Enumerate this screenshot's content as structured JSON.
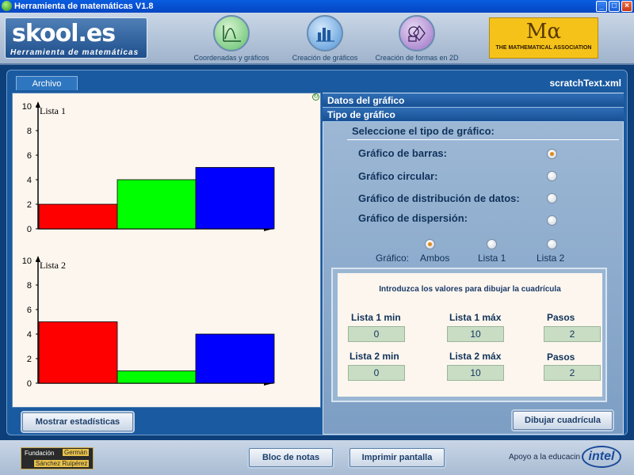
{
  "window": {
    "title": "Herramienta de matemáticas V1.8"
  },
  "logo": {
    "main": "skool.es",
    "sub": "Herramienta de matemáticas"
  },
  "nav": [
    {
      "label": "Coordenadas y gráficos",
      "icon": "coordinate-graph-icon"
    },
    {
      "label": "Creación de gráficos",
      "icon": "bar-chart-icon"
    },
    {
      "label": "Creación de formas en 2D",
      "icon": "shapes-icon"
    }
  ],
  "mathassoc": {
    "mark": "Mα",
    "text": "THE MATHEMATICAL ASSOCIATION"
  },
  "tab": {
    "archivo": "Archivo"
  },
  "file": {
    "name": "scratchText.xml"
  },
  "sections": {
    "datos": "Datos del gráfico",
    "tipo": "Tipo de gráfico"
  },
  "selector": {
    "title": "Seleccione el tipo de gráfico:",
    "options": [
      {
        "label": "Gráfico de barras:",
        "selected": true
      },
      {
        "label": "Gráfico circular:",
        "selected": false
      },
      {
        "label": "Gráfico de distribución de datos:",
        "selected": false
      },
      {
        "label": "Gráfico de dispersión:",
        "selected": false
      }
    ],
    "grafico_label": "Gráfico:",
    "show": [
      {
        "label": "Ambos",
        "selected": true
      },
      {
        "label": "Lista 1",
        "selected": false
      },
      {
        "label": "Lista 2",
        "selected": false
      }
    ]
  },
  "grid": {
    "title": "Introduzca los valores para dibujar la cuadrícula",
    "row1": {
      "min_label": "Lista 1 min",
      "min": "0",
      "max_label": "Lista 1 máx",
      "max": "10",
      "steps_label": "Pasos",
      "steps": "2"
    },
    "row2": {
      "min_label": "Lista 2 min",
      "min": "0",
      "max_label": "Lista 2 máx",
      "max": "10",
      "steps_label": "Pasos",
      "steps": "2"
    }
  },
  "buttons": {
    "stats": "Mostrar estadísticas",
    "draw": "Dibujar cuadrícula",
    "notes": "Bloc de notas",
    "print": "Imprimir pantalla"
  },
  "footer": {
    "fund_a": "Fundación",
    "fund_b": "Germán",
    "fund_c": "Sánchez Ruipérez",
    "apoyo": "Apoyo a la educacin",
    "intel": "intel"
  },
  "colors": {
    "red": "#ff0000",
    "green": "#00ff00",
    "blue": "#0000ff"
  },
  "chart_data": [
    {
      "type": "bar",
      "title": "Lista 1",
      "yticks": [
        "0",
        "2",
        "4",
        "6",
        "8",
        "10"
      ],
      "ylim": [
        0,
        10
      ],
      "values": [
        2,
        4,
        5
      ],
      "colors": [
        "#ff0000",
        "#00ff00",
        "#0000ff"
      ]
    },
    {
      "type": "bar",
      "title": "Lista 2",
      "yticks": [
        "0",
        "2",
        "4",
        "6",
        "8",
        "10"
      ],
      "ylim": [
        0,
        10
      ],
      "values": [
        5,
        1,
        4
      ],
      "colors": [
        "#ff0000",
        "#00ff00",
        "#0000ff"
      ]
    }
  ]
}
